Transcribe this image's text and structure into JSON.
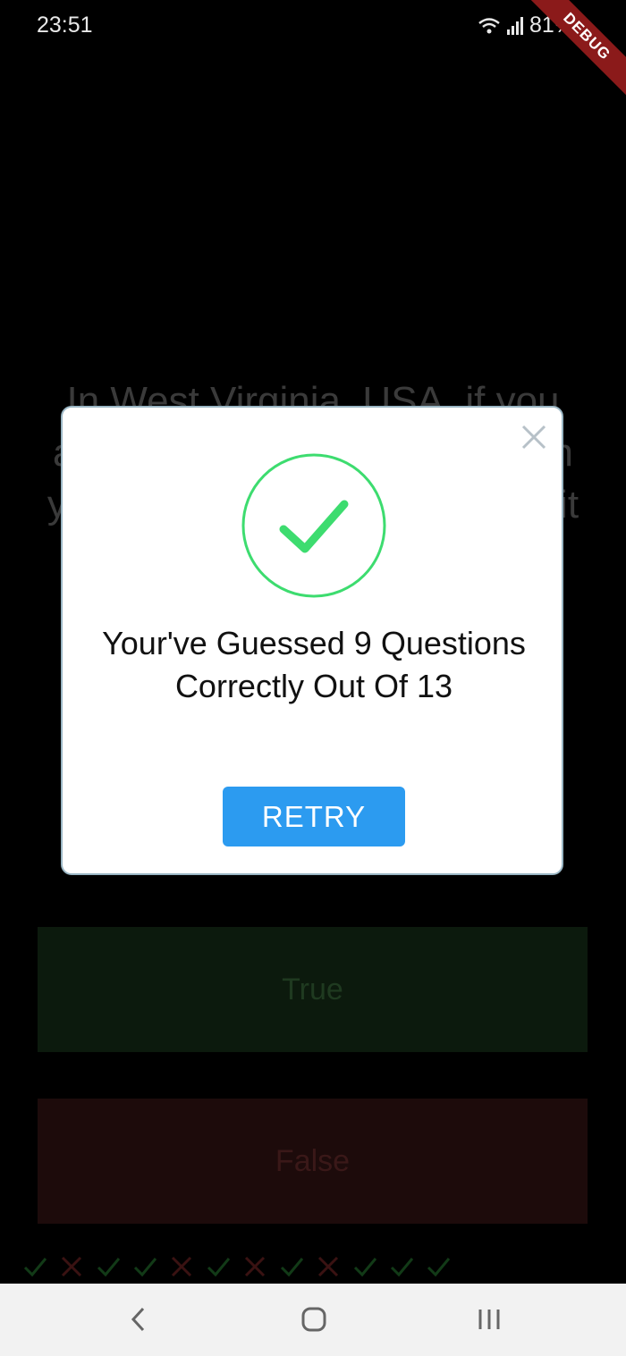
{
  "status_bar": {
    "time": "23:51",
    "battery": "81%",
    "debug_label": "DEBUG"
  },
  "quiz": {
    "question": "In West Virginia, USA, if you accidentally hit an animal with your car, you are free to take it",
    "true_label": "True",
    "false_label": "False",
    "score_marks": [
      "check",
      "cross",
      "check",
      "check",
      "cross",
      "check",
      "cross",
      "check",
      "cross",
      "check",
      "check",
      "check"
    ]
  },
  "dialog": {
    "result_text": "Your've Guessed 9 Questions Correctly Out Of 13",
    "retry_label": "RETRY",
    "success_color": "#3ddc6f",
    "retry_color": "#2c9bf0"
  },
  "nav": {
    "back_icon": "back-icon",
    "home_icon": "home-icon",
    "recents_icon": "recents-icon"
  }
}
